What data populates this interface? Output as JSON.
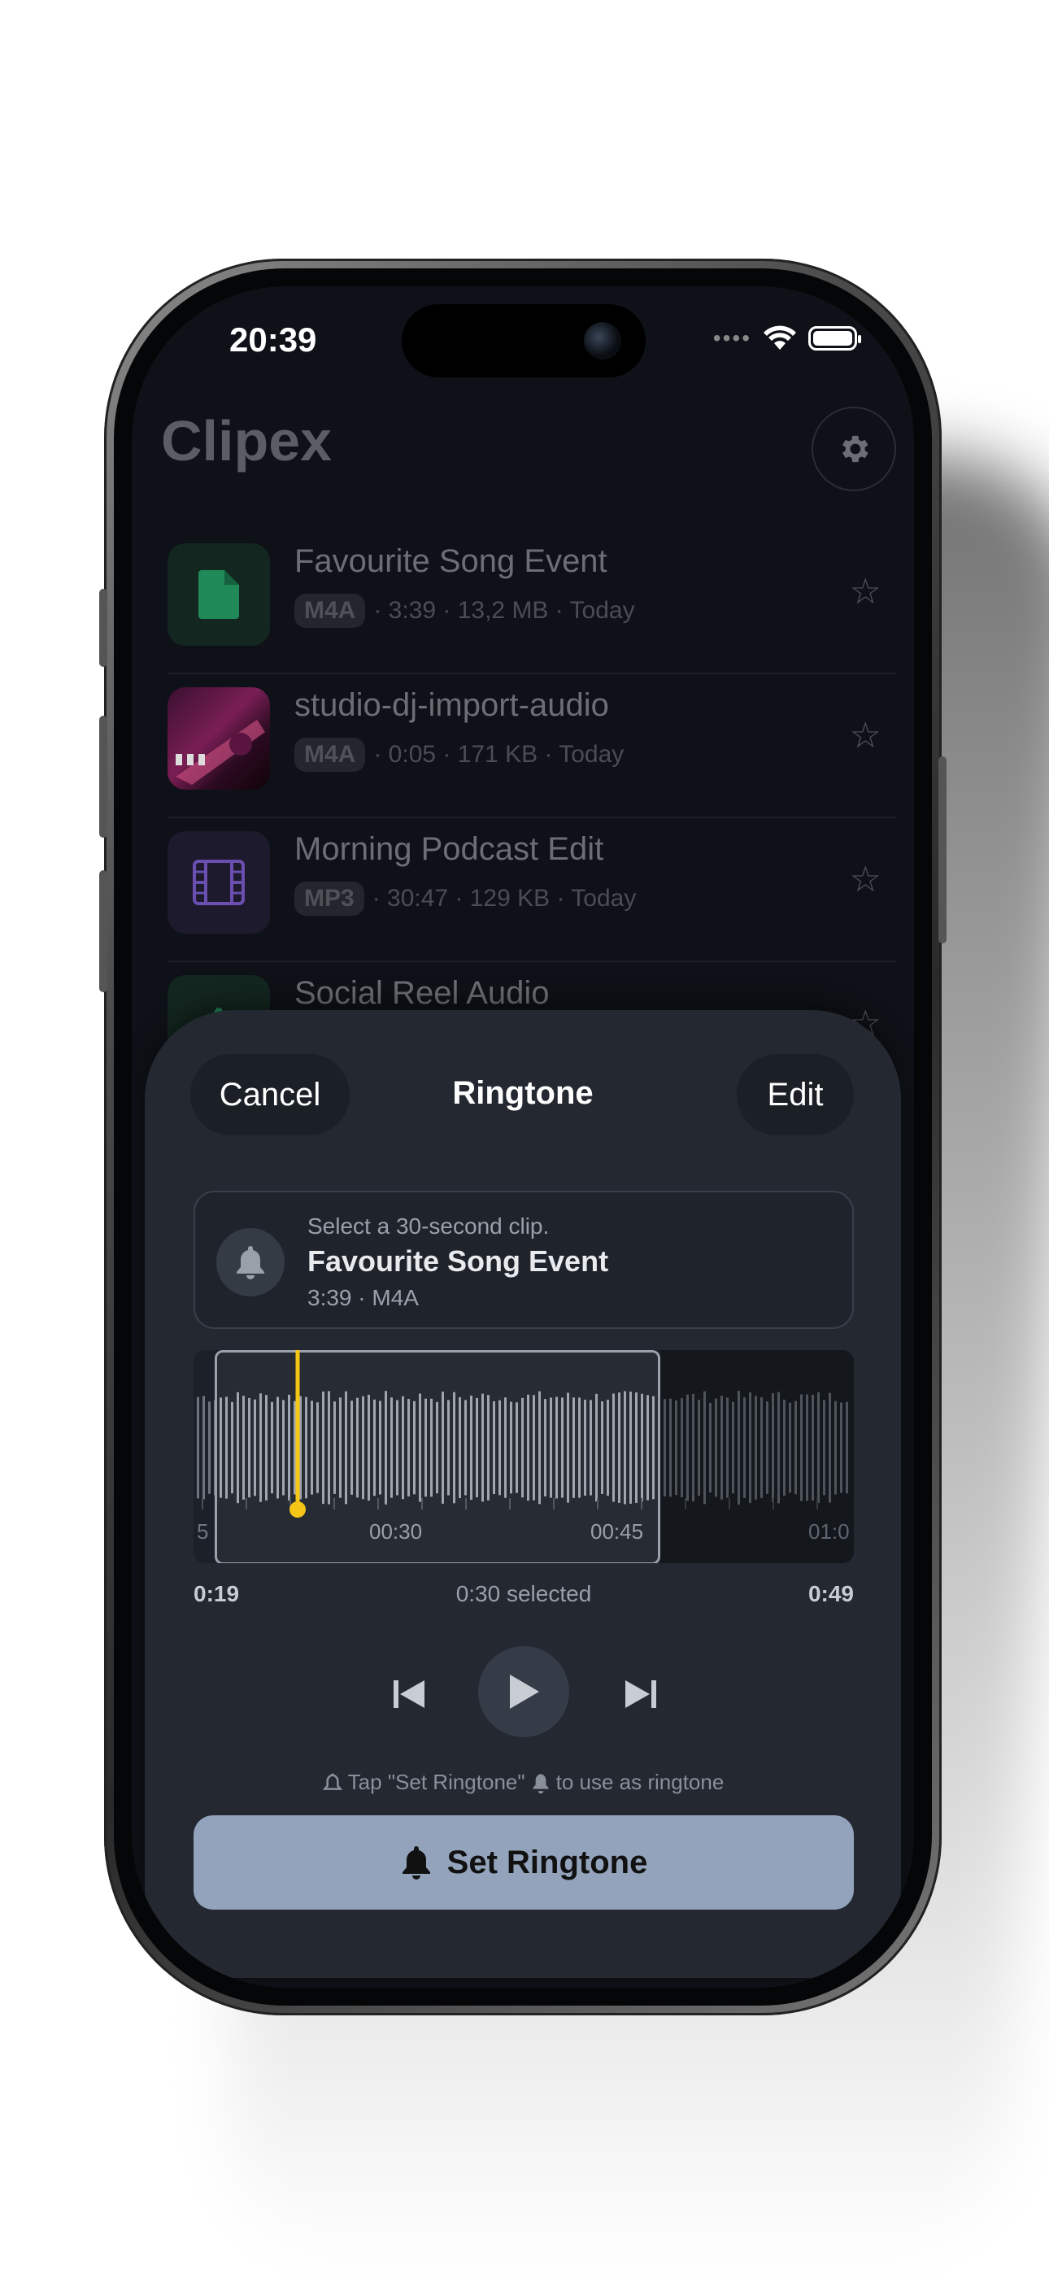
{
  "status_bar": {
    "time": "20:39"
  },
  "app": {
    "title": "Clipex"
  },
  "files": [
    {
      "title": "Favourite Song Event",
      "format": "M4A",
      "meta": "· 3:39 · 13,2 MB · Today",
      "thumb": "document-icon"
    },
    {
      "title": "studio-dj-import-audio",
      "format": "M4A",
      "meta": "· 0:05 · 171 KB · Today",
      "thumb": "dj-photo"
    },
    {
      "title": "Morning Podcast Edit",
      "format": "MP3",
      "meta": "· 30:47 · 129 KB · Today",
      "thumb": "film-icon"
    },
    {
      "title": "Social Reel Audio",
      "format": "",
      "meta": "",
      "thumb": "recycle-icon"
    }
  ],
  "sheet": {
    "cancel_label": "Cancel",
    "title": "Ringtone",
    "edit_label": "Edit",
    "hint": "Select a 30-second clip.",
    "file_title": "Favourite Song Event",
    "file_meta": "3:39 · M4A",
    "timeline": {
      "labels": [
        "5",
        "00:30",
        "00:45",
        "01:0"
      ]
    },
    "range_start": "0:19",
    "range_selected": "0:30 selected",
    "range_end": "0:49",
    "tip_before": "Tap \"Set Ringtone\"",
    "tip_after": "to use as ringtone",
    "set_button_label": "Set Ringtone"
  },
  "colors": {
    "accent_playhead": "#f5c518",
    "set_button": "#93a3bb",
    "sheet_bg": "#232831"
  }
}
